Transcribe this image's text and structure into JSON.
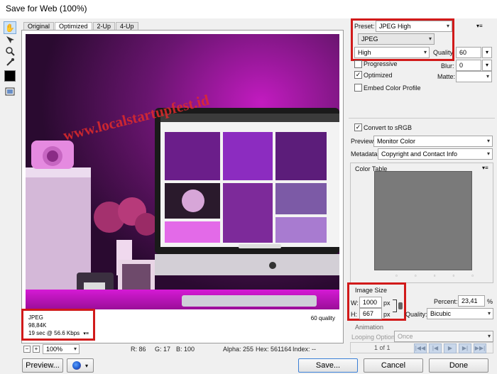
{
  "window": {
    "title": "Save for Web (100%)"
  },
  "tools": [
    "hand-tool",
    "slice-select-tool",
    "zoom-tool",
    "eyedropper-tool"
  ],
  "tabs": [
    {
      "label": "Original",
      "active": false
    },
    {
      "label": "Optimized",
      "active": true
    },
    {
      "label": "2-Up",
      "active": false
    },
    {
      "label": "4-Up",
      "active": false
    }
  ],
  "photo": {
    "watermark": "www.localstartupfest.id"
  },
  "info": {
    "format": "JPEG",
    "size": "98,84K",
    "speed": "19 sec @ 56.6 Kbps",
    "quality": "60 quality"
  },
  "status": {
    "zoom": "100%",
    "r": "R: 86",
    "g": "G: 17",
    "b": "B: 100",
    "alpha": "Alpha: 255",
    "hex": "Hex: 561164",
    "index": "Index: --"
  },
  "buttons": {
    "preview": "Preview...",
    "save": "Save...",
    "cancel": "Cancel",
    "done": "Done"
  },
  "settings": {
    "preset_label": "Preset:",
    "preset_value": "JPEG High",
    "format_value": "JPEG",
    "compression_value": "High",
    "quality_label": "Quality:",
    "quality_value": "60",
    "progressive_label": "Progressive",
    "progressive_checked": false,
    "blur_label": "Blur:",
    "blur_value": "0",
    "optimized_label": "Optimized",
    "optimized_checked": true,
    "matte_label": "Matte:",
    "embed_label": "Embed Color Profile",
    "embed_checked": false,
    "srgb_label": "Convert to sRGB",
    "srgb_checked": true,
    "preview_label": "Preview:",
    "preview_value": "Monitor Color",
    "metadata_label": "Metadata:",
    "metadata_value": "Copyright and Contact Info"
  },
  "color_table": {
    "title": "Color Table"
  },
  "image_size": {
    "title": "Image Size",
    "w_label": "W:",
    "w_value": "1000",
    "h_label": "H:",
    "h_value": "667",
    "unit": "px",
    "percent_label": "Percent:",
    "percent_value": "23,41",
    "percent_unit": "%",
    "quality_label": "Quality:",
    "quality_value": "Bicubic"
  },
  "animation": {
    "title": "Animation",
    "looping_label": "Looping Options:",
    "looping_value": "Once",
    "frame": "1 of 1"
  },
  "colors": {
    "selection": "#d11a1a",
    "photo_glow": "#e21ee0"
  }
}
